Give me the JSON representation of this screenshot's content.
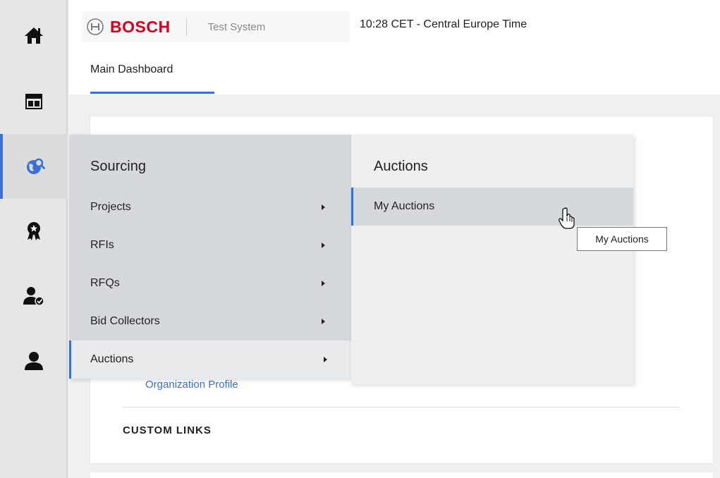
{
  "header": {
    "brand_name": "BOSCH",
    "system_label": "Test System",
    "clock": "10:28 CET - Central Europe Time",
    "tab_label": "Main Dashboard"
  },
  "rail": {
    "items": [
      {
        "icon": "home-icon"
      },
      {
        "icon": "dashboard-icon"
      },
      {
        "icon": "sourcing-globe-icon",
        "active": true
      },
      {
        "icon": "award-icon"
      },
      {
        "icon": "user-check-icon"
      },
      {
        "icon": "user-icon"
      }
    ]
  },
  "card": {
    "partial_link": "Organization Profile",
    "custom_links_heading": "CUSTOM LINKS"
  },
  "menu": {
    "heading": "Sourcing",
    "items": [
      {
        "label": "Projects"
      },
      {
        "label": "RFIs"
      },
      {
        "label": "RFQs"
      },
      {
        "label": "Bid Collectors"
      },
      {
        "label": "Auctions",
        "active": true
      }
    ]
  },
  "submenu": {
    "heading": "Auctions",
    "items": [
      {
        "label": "My Auctions",
        "hovered": true
      }
    ]
  },
  "tooltip": {
    "text": "My Auctions"
  },
  "colors": {
    "accent": "#3a6fd8",
    "brand_red": "#d9001b"
  }
}
